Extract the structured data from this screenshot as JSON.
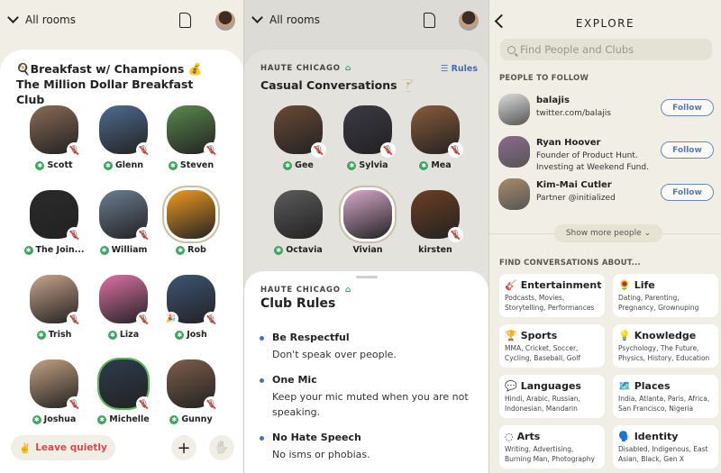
{
  "panel1": {
    "nav_label": "All rooms",
    "room_title": "🍳Breakfast w/ Champions 💰The Million Dollar Breakfast Club",
    "speakers": [
      {
        "name": "Scott",
        "new": true,
        "muted": true,
        "color": "#8a6b55"
      },
      {
        "name": "Glenn",
        "new": true,
        "muted": true,
        "color": "#4f6c92"
      },
      {
        "name": "Steven",
        "new": true,
        "muted": true,
        "color": "#5a8a4e"
      },
      {
        "name": "The Join...",
        "new": true,
        "muted": true,
        "color": "#2a2a2a"
      },
      {
        "name": "William",
        "new": true,
        "muted": true,
        "color": "#6c7d92"
      },
      {
        "name": "Rob",
        "new": true,
        "muted": false,
        "speaking": true,
        "color": "#f09a1f"
      },
      {
        "name": "Trish",
        "new": true,
        "muted": true,
        "color": "#c9a48c"
      },
      {
        "name": "Liza",
        "new": true,
        "muted": true,
        "color": "#e072a8"
      },
      {
        "name": "Josh",
        "new": true,
        "muted": true,
        "color": "#3e5576",
        "badge": "🎉"
      },
      {
        "name": "Joshua",
        "new": true,
        "muted": true,
        "color": "#c4a183"
      },
      {
        "name": "Michelle",
        "new": true,
        "muted": true,
        "color": "#2d3c4e",
        "green_ring": true
      },
      {
        "name": "Gunny",
        "new": true,
        "muted": true,
        "color": "#7e5e4b"
      }
    ],
    "leave_label": "Leave quietly",
    "leave_emoji": "✌️",
    "add_icon": "+",
    "raise_hand_icon": "✋"
  },
  "panel2": {
    "nav_label": "All rooms",
    "club_name": "HAUTE CHICAGO",
    "rules_label": "Rules",
    "room_title": "Casual Conversations 🍸",
    "speakers": [
      {
        "name": "Gee",
        "new": true,
        "muted": true,
        "color": "#6b4a36"
      },
      {
        "name": "Sylvia",
        "new": true,
        "muted": true,
        "color": "#3b3a45"
      },
      {
        "name": "Mea",
        "new": true,
        "muted": true,
        "color": "#8a5b3b"
      },
      {
        "name": "Octavia",
        "new": true,
        "muted": false,
        "color": "#5c5c5c"
      },
      {
        "name": "Vivian",
        "new": false,
        "muted": false,
        "speaking": true,
        "color": "#d9a9cc"
      },
      {
        "name": "kirsten",
        "new": false,
        "muted": true,
        "color": "#6d3f24"
      }
    ],
    "sheet": {
      "club_name": "HAUTE CHICAGO",
      "title": "Club Rules",
      "rules": [
        {
          "title": "Be Respectful",
          "desc": "Don't speak over people."
        },
        {
          "title": "One Mic",
          "desc": "Keep your mic muted when you are not speaking."
        },
        {
          "title": "No Hate Speech",
          "desc": "No isms or phobias."
        }
      ]
    }
  },
  "panel3": {
    "title": "EXPLORE",
    "search_placeholder": "Find People and Clubs",
    "people_header": "PEOPLE TO FOLLOW",
    "people": [
      {
        "name": "balajis",
        "bio": "twitter.com/balajis",
        "follow_label": "Follow",
        "color": "#dcdcdc"
      },
      {
        "name": "Ryan Hoover",
        "bio": "Founder of Product Hunt. Investing at Weekend Fund.",
        "follow_label": "Follow",
        "color": "#8d6a8e"
      },
      {
        "name": "Kim-Mai Cutler",
        "bio": "Partner @initialized",
        "follow_label": "Follow",
        "color": "#a88c6a"
      }
    ],
    "show_more_label": "Show more people",
    "topics_header": "FIND CONVERSATIONS ABOUT...",
    "topics": [
      {
        "emoji": "🎸",
        "title": "Entertainment",
        "desc": "Podcasts, Movies, Storytelling, Performances"
      },
      {
        "emoji": "🌻",
        "title": "Life",
        "desc": "Dating, Parenting, Pregnancy, Grownuping"
      },
      {
        "emoji": "🏆",
        "title": "Sports",
        "desc": "MMA, Cricket, Soccer, Cycling, Baseball, Golf"
      },
      {
        "emoji": "💡",
        "title": "Knowledge",
        "desc": "Psychology, The Future, Physics, History, Education"
      },
      {
        "emoji": "💬",
        "title": "Languages",
        "desc": "Hindi, Arabic, Russian, Indonesian, Mandarin"
      },
      {
        "emoji": "🗺️",
        "title": "Places",
        "desc": "India, Atlanta, Paris, Africa, San Francisco, Nigeria"
      },
      {
        "emoji": "◌",
        "title": "Arts",
        "desc": "Writing, Advertising, Burning Man, Photography"
      },
      {
        "emoji": "🗣️",
        "title": "Identity",
        "desc": "Disabled, Indigenous, East Asian, Black, Gen X"
      }
    ]
  }
}
